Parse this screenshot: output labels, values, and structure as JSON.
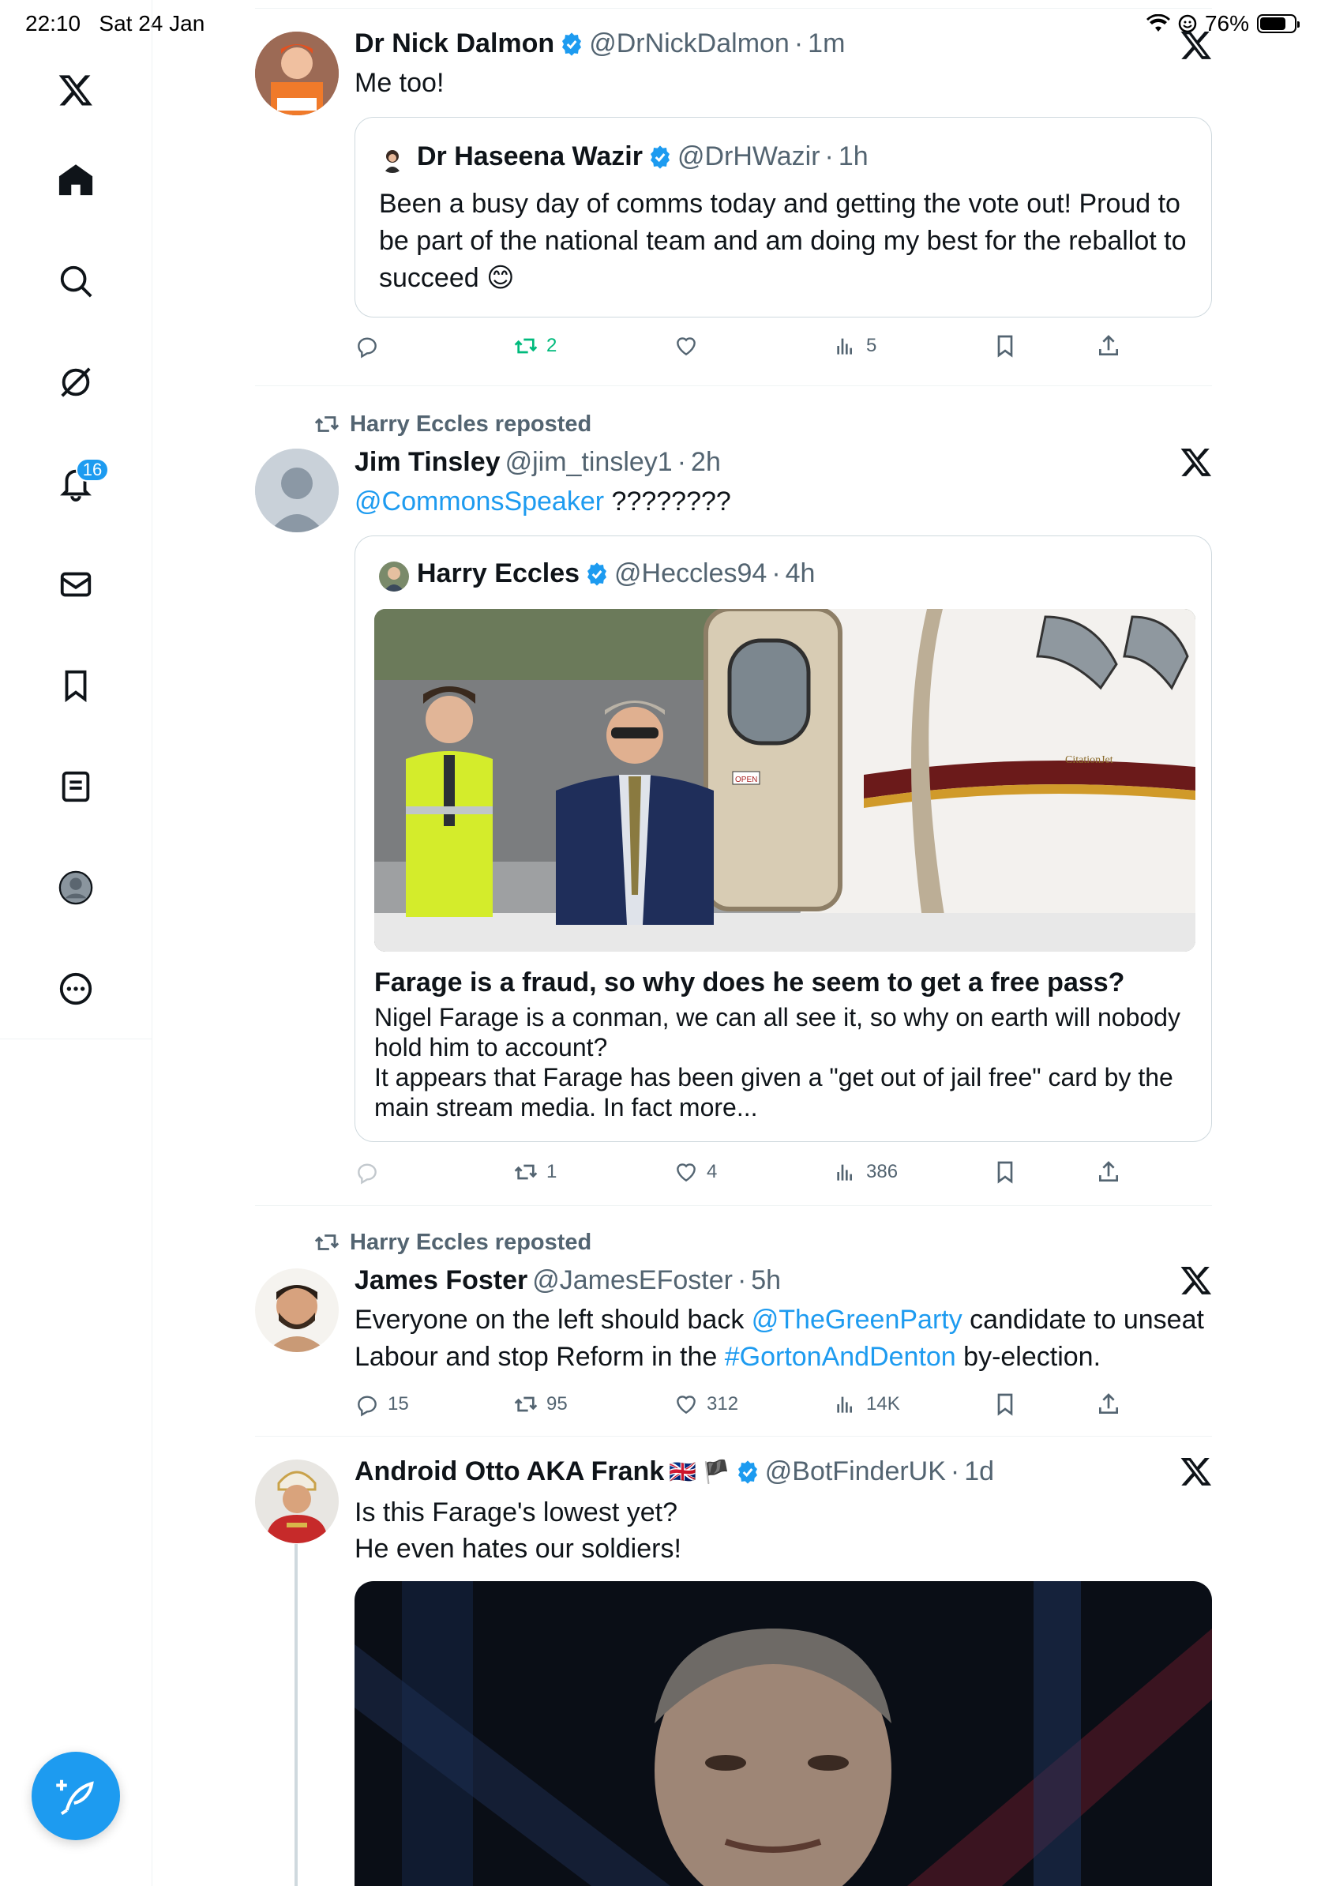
{
  "status_bar": {
    "time": "22:10",
    "date": "Sat 24 Jan",
    "battery": "76%",
    "battery_level": 0.76
  },
  "sidebar": {
    "items": [
      {
        "icon": "x-logo-icon"
      },
      {
        "icon": "home-icon"
      },
      {
        "icon": "search-icon"
      },
      {
        "icon": "grok-icon"
      },
      {
        "icon": "notifications-icon",
        "badge": "16"
      },
      {
        "icon": "messages-icon"
      },
      {
        "icon": "bookmarks-icon"
      },
      {
        "icon": "lists-icon"
      },
      {
        "icon": "profile-icon"
      },
      {
        "icon": "more-icon"
      }
    ],
    "compose_icon": "compose-post-icon"
  },
  "colors": {
    "accent": "#1d9bf0",
    "repost_active": "#00ba7c",
    "text_primary": "#0f1419",
    "text_secondary": "#536471",
    "border": "#cfd9de"
  },
  "tweets": [
    {
      "name": "Dr Nick Dalmon",
      "handle": "@DrNickDalmon",
      "time": "1m",
      "text": "Me too!",
      "quote": {
        "name": "Dr Haseena Wazir",
        "handle": "@DrHWazir",
        "time": "1h",
        "text": "Been a busy day of comms today and getting the vote out! Proud to be part of the national team and am doing my best for the reballot to succeed 😊"
      },
      "actions": {
        "replies": "",
        "reposts": "2",
        "likes": "",
        "views": "5"
      }
    },
    {
      "repost_label": "Harry Eccles reposted",
      "name": "Jim Tinsley",
      "handle": "@jim_tinsley1",
      "time": "2h",
      "mention": "@CommonsSpeaker",
      "text": "????????",
      "quote": {
        "name": "Harry Eccles",
        "handle": "@Heccles94",
        "time": "4h",
        "image_sign_open": "OPEN",
        "image_plane_brand": "CitationJet",
        "article_title": "Farage is a fraud, so why does he seem to get a free pass?",
        "article_text": "Nigel Farage is a conman, we can all see it, so why on earth will nobody hold him to account?\nIt appears that Farage has been given a \"get out of jail free\" card by the main stream media. In fact more..."
      },
      "actions": {
        "replies": "",
        "reposts": "1",
        "likes": "4",
        "views": "386"
      }
    },
    {
      "repost_label": "Harry Eccles reposted",
      "name": "James Foster",
      "handle": "@JamesEFoster",
      "time": "5h",
      "text_part1": "Everyone on the left should back ",
      "mention": "@TheGreenParty",
      "text_part2": " candidate to unseat Labour and stop Reform in the ",
      "hashtag": "#GortonAndDenton",
      "text_part3": " by-election.",
      "actions": {
        "replies": "15",
        "reposts": "95",
        "likes": "312",
        "views": "14K"
      }
    },
    {
      "name": "Android Otto AKA Frank",
      "flags": "🇬🇧 🏴",
      "handle": "@BotFinderUK",
      "time": "1d",
      "text_line1": "Is this Farage's lowest yet?",
      "text_line2": "He even hates our soldiers!"
    }
  ],
  "dot": "·"
}
